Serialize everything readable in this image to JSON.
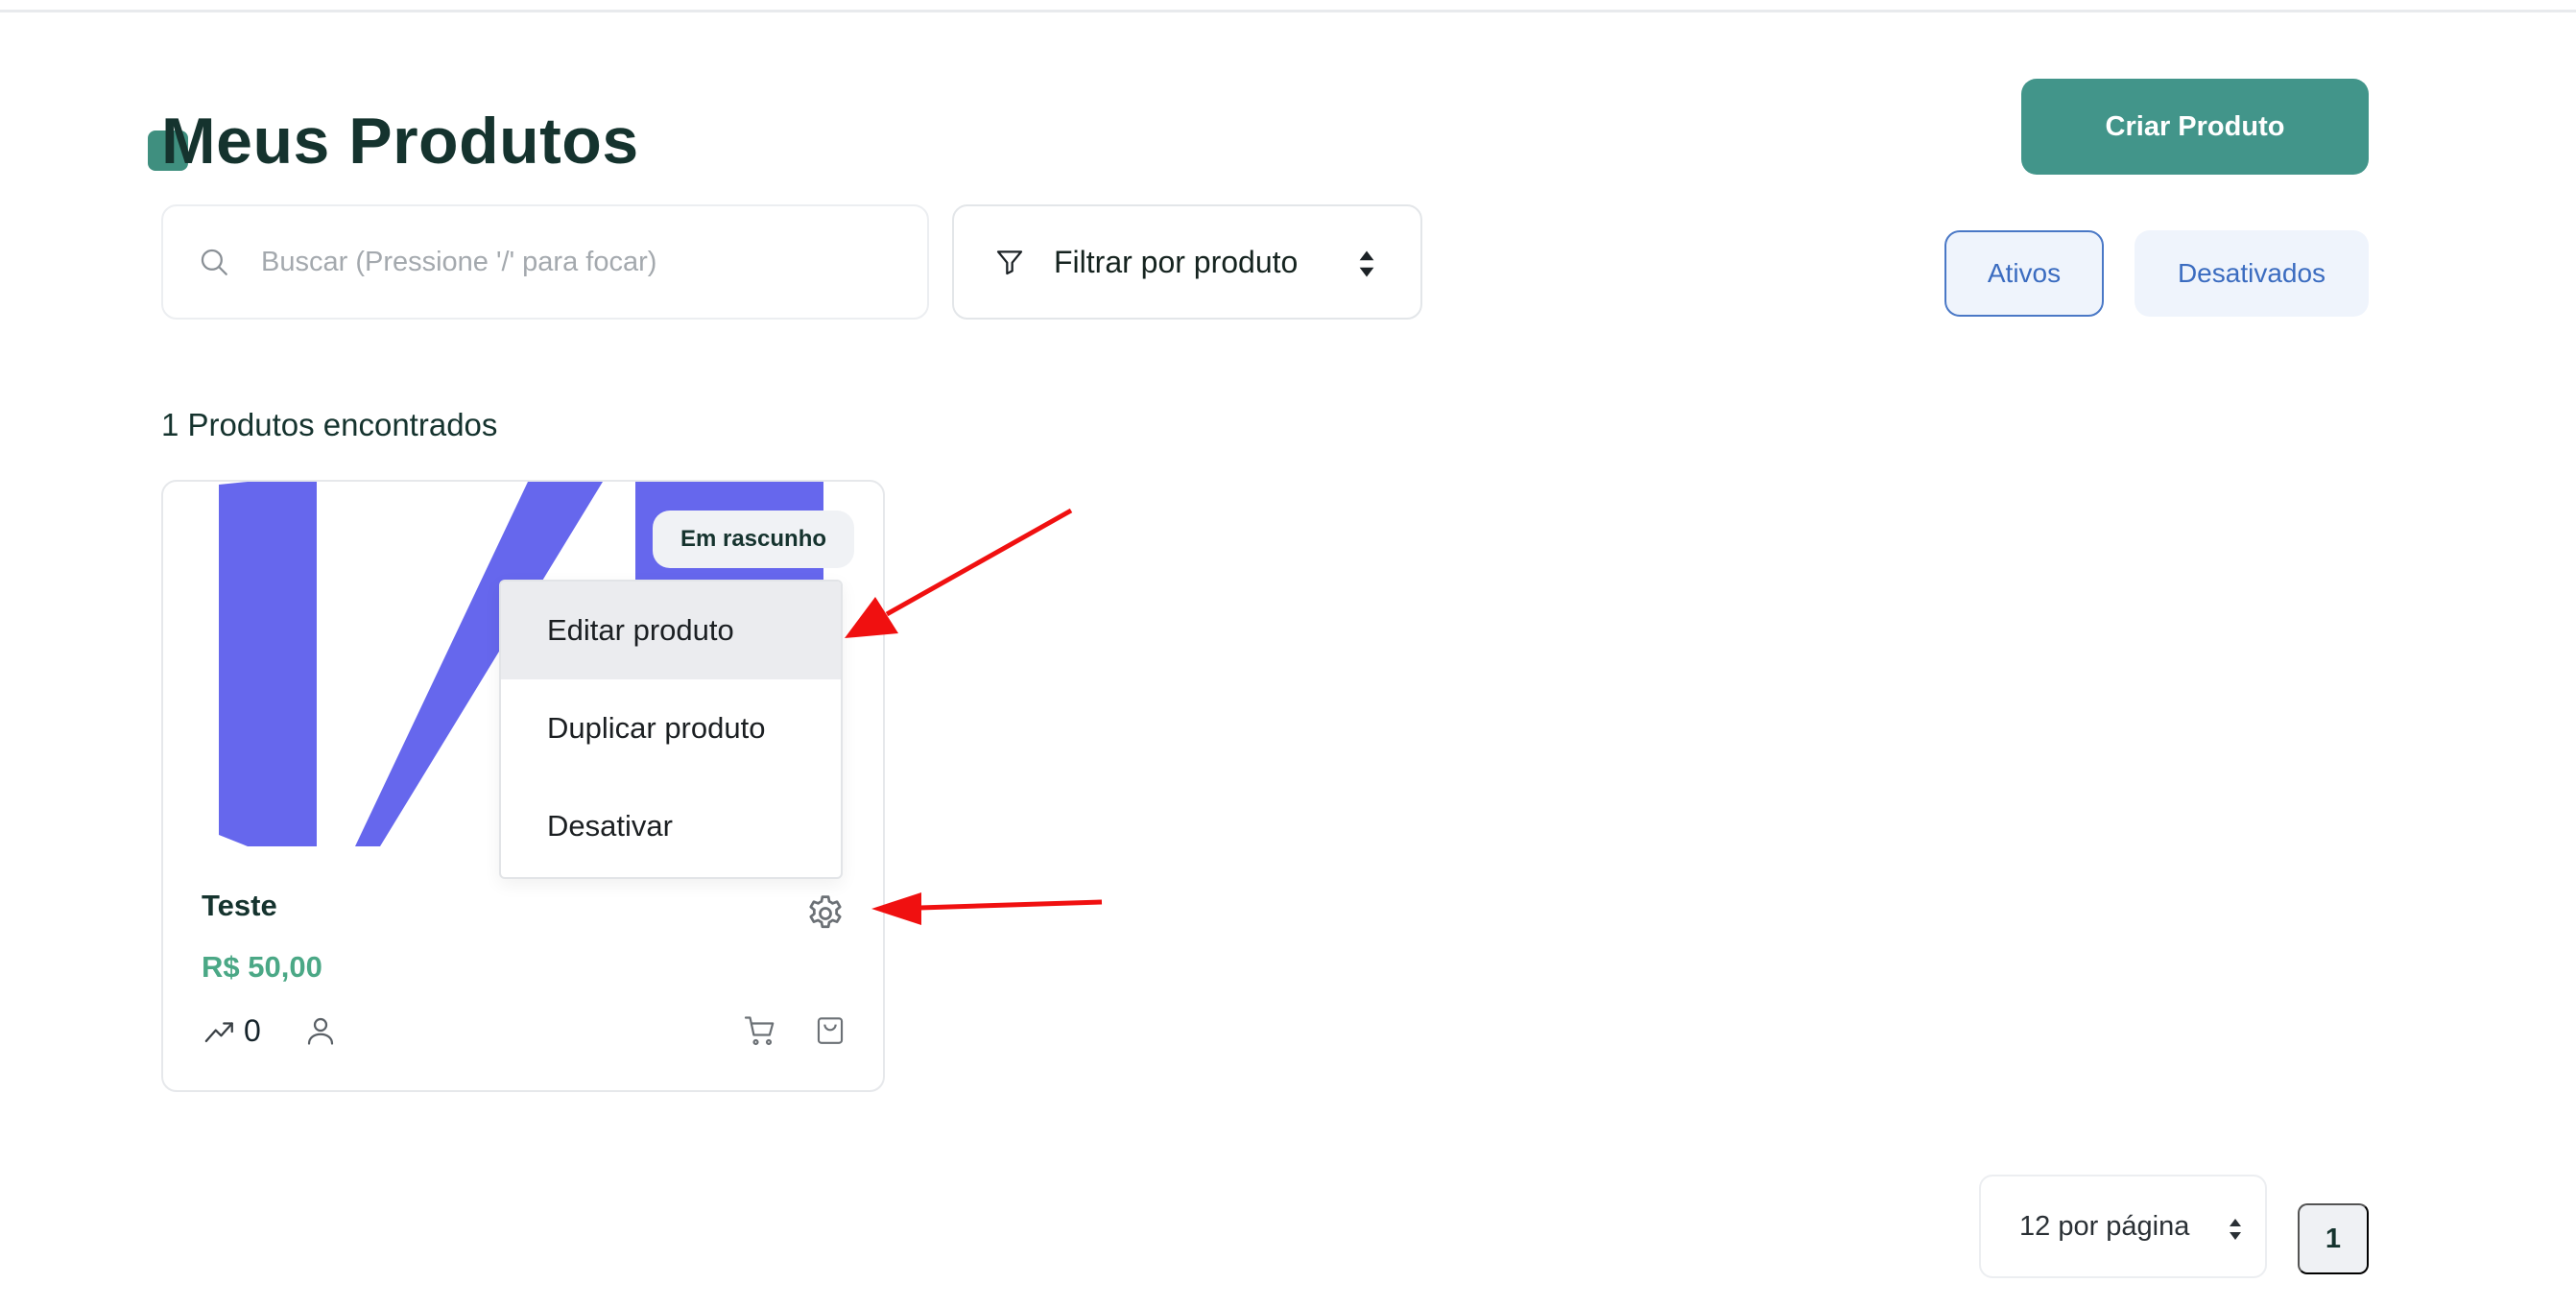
{
  "header": {
    "title": "Meus Produtos",
    "create_button": "Criar Produto"
  },
  "search": {
    "value": "",
    "placeholder": "Buscar (Pressione '/' para focar)"
  },
  "filter": {
    "selected": "Filtrar por produto"
  },
  "status_tabs": [
    {
      "label": "Ativos",
      "active": true
    },
    {
      "label": "Desativados",
      "active": false
    }
  ],
  "results": {
    "count_text": "1 Produtos encontrados"
  },
  "products": [
    {
      "name": "Teste",
      "price": "R$ 50,00",
      "badge": "Em rascunho",
      "sales": "0"
    }
  ],
  "context_menu": {
    "items": [
      "Editar produto",
      "Duplicar produto",
      "Desativar"
    ],
    "highlighted_index": 0
  },
  "pagination": {
    "per_page": "12 por página",
    "current_page": "1"
  },
  "colors": {
    "primary": "#42958a",
    "price": "#4ba886",
    "tab_accent": "#3b6cc0",
    "product_image": "#6667ed",
    "annotation_arrow": "#f01010"
  }
}
